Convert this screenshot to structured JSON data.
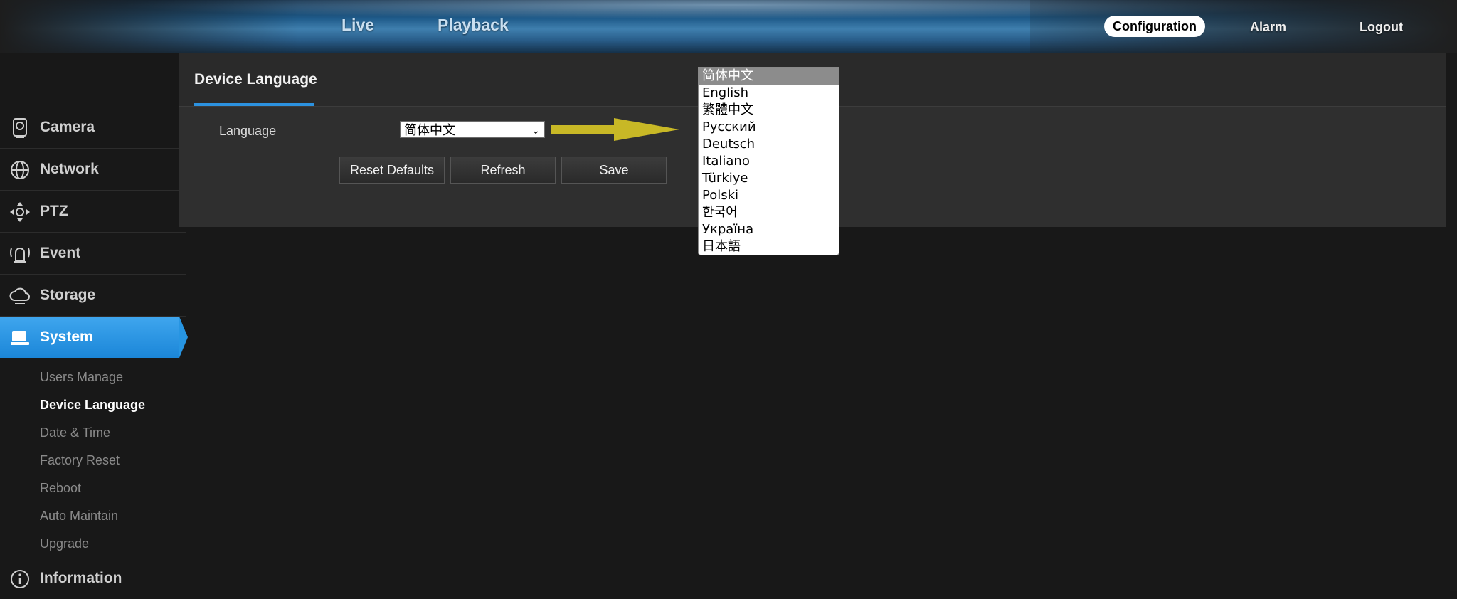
{
  "topnav": {
    "live": "Live",
    "playback": "Playback",
    "configuration": "Configuration",
    "alarm": "Alarm",
    "logout": "Logout"
  },
  "sidebar": {
    "items": [
      {
        "label": "Camera",
        "icon": "camera-icon"
      },
      {
        "label": "Network",
        "icon": "network-icon"
      },
      {
        "label": "PTZ",
        "icon": "ptz-icon"
      },
      {
        "label": "Event",
        "icon": "event-icon"
      },
      {
        "label": "Storage",
        "icon": "storage-icon"
      },
      {
        "label": "System",
        "icon": "system-icon",
        "active": true
      },
      {
        "label": "Information",
        "icon": "information-icon"
      }
    ],
    "system_sub": [
      "Users Manage",
      "Device Language",
      "Date & Time",
      "Factory Reset",
      "Reboot",
      "Auto Maintain",
      "Upgrade"
    ],
    "active_sub": "Device Language"
  },
  "page": {
    "title": "Device Language",
    "language_label": "Language",
    "selected_language": "简体中文",
    "buttons": {
      "reset": "Reset Defaults",
      "refresh": "Refresh",
      "save": "Save"
    }
  },
  "dropdown": {
    "options": [
      "简体中文",
      "English",
      "繁體中文",
      "Русский",
      "Deutsch",
      "Italiano",
      "Türkiye",
      "Polski",
      "한국어",
      "Україна",
      "日本語"
    ],
    "selected_index": 0
  },
  "colors": {
    "accent": "#2795e2",
    "arrow": "#c8b826",
    "panel": "#2f2f2f",
    "background": "#181818"
  }
}
